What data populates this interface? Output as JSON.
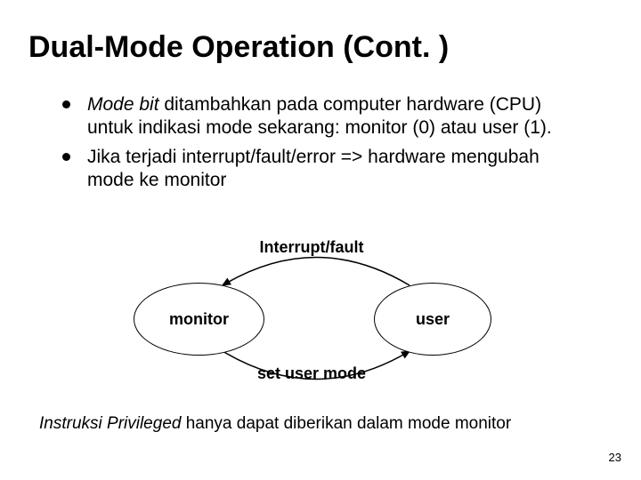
{
  "title": "Dual-Mode Operation (Cont. )",
  "bullets": [
    {
      "emph": "Mode bit",
      "rest": " ditambahkan pada computer hardware (CPU) untuk indikasi mode sekarang: monitor (0) atau user (1)."
    },
    {
      "emph": "",
      "rest": "Jika terjadi interrupt/fault/error => hardware mengubah mode ke monitor"
    }
  ],
  "diagram": {
    "top_label": "Interrupt/fault",
    "bottom_label": "set user mode",
    "left_node": "monitor",
    "right_node": "user"
  },
  "footer": {
    "emph": "Instruksi Privileged",
    "rest": " hanya dapat diberikan dalam mode monitor"
  },
  "page_number": "23"
}
